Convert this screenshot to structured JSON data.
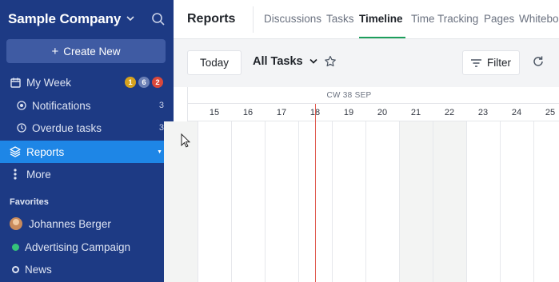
{
  "sidebar": {
    "company_name": "Sample Company",
    "create_label": "Create New",
    "items": [
      {
        "label": "My Week",
        "icon": "calendar-icon"
      },
      {
        "label": "Notifications",
        "icon": "radio-dot-icon",
        "count": "3"
      },
      {
        "label": "Overdue tasks",
        "icon": "clock-icon",
        "count": "3"
      },
      {
        "label": "Reports",
        "icon": "layers-icon",
        "active": true
      },
      {
        "label": "More",
        "icon": "more-vertical-icon"
      }
    ],
    "badges": [
      {
        "value": "1",
        "color": "#d6a21e"
      },
      {
        "value": "6",
        "color": "#6b7fb5"
      },
      {
        "value": "2",
        "color": "#d9483b"
      }
    ],
    "favorites_title": "Favorites",
    "favorites": [
      {
        "label": "Johannes Berger",
        "icon": "avatar"
      },
      {
        "label": "Advertising Campaign",
        "icon": "green-dot-icon"
      },
      {
        "label": "News",
        "icon": "ring-icon"
      }
    ]
  },
  "header": {
    "title": "Reports",
    "tabs": [
      {
        "label": "Discussions"
      },
      {
        "label": "Tasks"
      },
      {
        "label": "Timeline",
        "active": true
      },
      {
        "label": "Time Tracking"
      },
      {
        "label": "Pages"
      },
      {
        "label": "Whiteboa"
      }
    ]
  },
  "toolbar": {
    "today_label": "Today",
    "view_label": "All Tasks",
    "filter_label": "Filter"
  },
  "timeline": {
    "week_label": "CW 38 SEP",
    "days": [
      "15",
      "16",
      "17",
      "18",
      "19",
      "20",
      "21",
      "22",
      "23",
      "24",
      "25"
    ],
    "today_day": "18"
  },
  "colors": {
    "sidebar_bg": "#1d3a84",
    "active_item": "#1e86e6",
    "tab_underline": "#1d9e5b",
    "today_line": "#e05a4f"
  }
}
